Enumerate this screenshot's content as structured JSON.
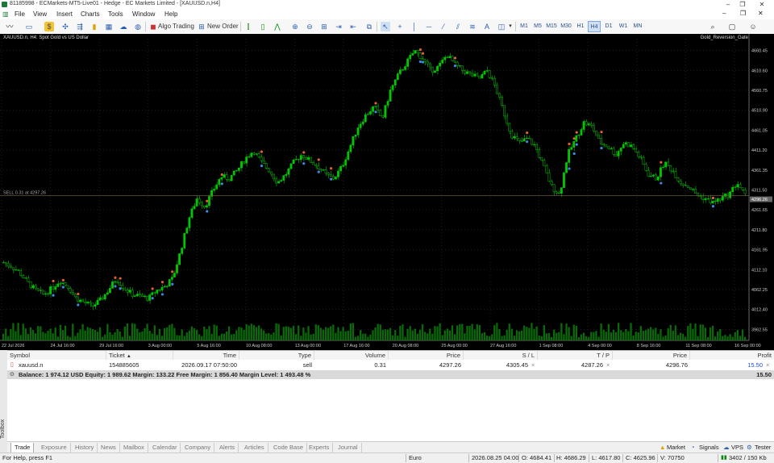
{
  "window": {
    "title": "81185998 - ECMarkets-MT5-Live01 - Hedge - EC Markets Limited - [XAUUSD.n,H4]",
    "controls": [
      "–",
      "❐",
      "✕"
    ]
  },
  "menu": [
    "File",
    "View",
    "Insert",
    "Charts",
    "Tools",
    "Window",
    "Help"
  ],
  "toolbar": {
    "algo_trading": "Algo Trading",
    "new_order": "New Order",
    "timeframes": [
      "M1",
      "M5",
      "M15",
      "M30",
      "H1",
      "H4",
      "D1",
      "W1",
      "MN"
    ],
    "active_timeframe": "H4"
  },
  "chart": {
    "symbol_label": "XAUUSD.n, H4:  Spot Gold vs US Dollar",
    "ea_label": "Gold_Reversion_Gate",
    "position_line_label": "SELL 0.31 at 4297.26",
    "current_price_label": "4296.26",
    "colors": {
      "bull": "#00c800",
      "bear": "#00c800",
      "grid": "#1e1e1e",
      "position_line": "#7a6a3a",
      "volume": "#0a6a0a"
    }
  },
  "chart_data": {
    "type": "candlestick",
    "symbol": "XAUUSD.n",
    "timeframe": "H4",
    "y_ticks": [
      4660.45,
      4610.6,
      4560.75,
      4510.9,
      4461.05,
      4411.2,
      4361.35,
      4311.5,
      4261.65,
      4211.8,
      4161.95,
      4112.1,
      4062.25,
      4012.4,
      3962.55
    ],
    "ylim": [
      3935,
      4690
    ],
    "x_ticks": [
      "22 Jul 2026",
      "24 Jul 16:00",
      "29 Jul 16:00",
      "3 Aug 00:00",
      "5 Aug 16:00",
      "10 Aug 08:00",
      "13 Aug 00:00",
      "17 Aug 16:00",
      "20 Aug 08:00",
      "25 Aug 00:00",
      "27 Aug 16:00",
      "1 Sep 08:00",
      "4 Sep 00:00",
      "8 Sep 16:00",
      "11 Sep 08:00",
      "16 Sep 00:00"
    ],
    "close_path": [
      4130,
      4120,
      4105,
      4080,
      4060,
      4050,
      4065,
      4085,
      4070,
      4040,
      4030,
      4020,
      4035,
      4060,
      4090,
      4065,
      4050,
      4045,
      4040,
      4060,
      4070,
      4090,
      4160,
      4240,
      4290,
      4270,
      4310,
      4345,
      4340,
      4360,
      4390,
      4410,
      4380,
      4360,
      4330,
      4350,
      4380,
      4400,
      4385,
      4370,
      4350,
      4340,
      4370,
      4420,
      4470,
      4500,
      4520,
      4490,
      4560,
      4600,
      4630,
      4660,
      4640,
      4610,
      4620,
      4650,
      4625,
      4610,
      4600,
      4590,
      4610,
      4570,
      4510,
      4450,
      4430,
      4440,
      4420,
      4370,
      4320,
      4300,
      4400,
      4440,
      4480,
      4470,
      4430,
      4420,
      4400,
      4430,
      4420,
      4390,
      4350,
      4340,
      4380,
      4360,
      4330,
      4320,
      4300,
      4290,
      4280,
      4290,
      4300,
      4330,
      4297
    ],
    "sell_position": {
      "volume": 0.31,
      "price": 4297.26
    }
  },
  "terminal": {
    "headers": [
      "Symbol",
      "Ticket",
      "Time",
      "Type",
      "Volume",
      "Price",
      "S / L",
      "T / P",
      "Price",
      "Profit"
    ],
    "row": {
      "symbol": "xauusd.n",
      "ticket": "154885605",
      "time": "2026.09.17 07:50:00",
      "type": "sell",
      "volume": "0.31",
      "price": "4297.26",
      "sl": "4305.45",
      "tp": "4287.26",
      "current_price": "4296.76",
      "profit": "15.50"
    },
    "balance_text": "Balance: 1 974.12 USD  Equity: 1 989.62  Margin: 133.22  Free Margin: 1 856.40  Margin Level: 1 493.48 %",
    "balance_profit": "15.50",
    "toolbox_label": "Toolbox"
  },
  "tabs": [
    "Trade",
    "Exposure",
    "History",
    "News",
    "Mailbox",
    "Calendar",
    "Company",
    "Alerts",
    "Articles",
    "Code Base",
    "Experts",
    "Journal"
  ],
  "active_tab": "Trade",
  "right_tabs": [
    "Market",
    "Signals",
    "VPS",
    "Tester"
  ],
  "status": {
    "help": "For Help, press F1",
    "profile": "Euro",
    "datetime": "2026.08.25 04:00",
    "open": "O: 4684.41",
    "high": "H: 4686.29",
    "low": "L: 4617.80",
    "close": "C: 4625.96",
    "volume": "V: 70750",
    "traffic": "3402 / 150 Kb"
  }
}
